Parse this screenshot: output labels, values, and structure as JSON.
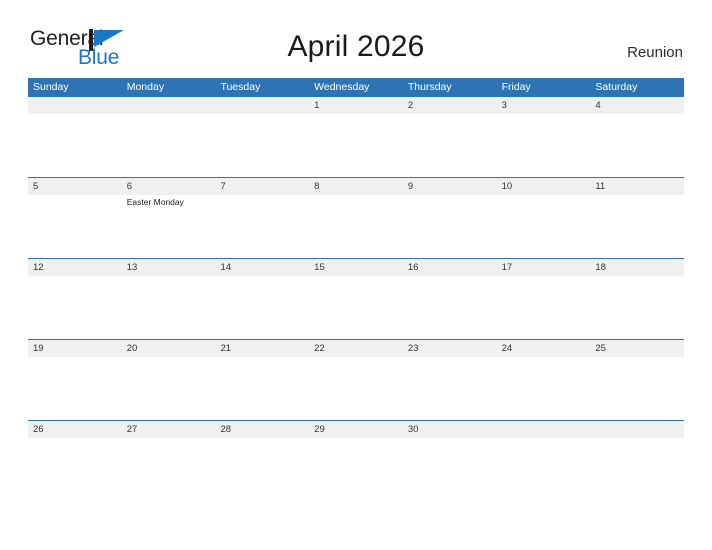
{
  "brand": {
    "name_top": "General",
    "name_bottom": "Blue",
    "color_dark": "#231f20",
    "color_blue": "#1878c4"
  },
  "header": {
    "title": "April 2026",
    "region": "Reunion"
  },
  "theme": {
    "header_blue": "#2e74b5",
    "band_gray": "#f0f0f0",
    "page_background": "#ffffff"
  },
  "weekdays": [
    {
      "label": "Sunday"
    },
    {
      "label": "Monday"
    },
    {
      "label": "Tuesday"
    },
    {
      "label": "Wednesday"
    },
    {
      "label": "Thursday"
    },
    {
      "label": "Friday"
    },
    {
      "label": "Saturday"
    }
  ],
  "weeks": [
    {
      "days": [
        {
          "date": "",
          "event": ""
        },
        {
          "date": "",
          "event": ""
        },
        {
          "date": "",
          "event": ""
        },
        {
          "date": "1",
          "event": ""
        },
        {
          "date": "2",
          "event": ""
        },
        {
          "date": "3",
          "event": ""
        },
        {
          "date": "4",
          "event": ""
        }
      ]
    },
    {
      "days": [
        {
          "date": "5",
          "event": ""
        },
        {
          "date": "6",
          "event": "Easter Monday"
        },
        {
          "date": "7",
          "event": ""
        },
        {
          "date": "8",
          "event": ""
        },
        {
          "date": "9",
          "event": ""
        },
        {
          "date": "10",
          "event": ""
        },
        {
          "date": "11",
          "event": ""
        }
      ]
    },
    {
      "days": [
        {
          "date": "12",
          "event": ""
        },
        {
          "date": "13",
          "event": ""
        },
        {
          "date": "14",
          "event": ""
        },
        {
          "date": "15",
          "event": ""
        },
        {
          "date": "16",
          "event": ""
        },
        {
          "date": "17",
          "event": ""
        },
        {
          "date": "18",
          "event": ""
        }
      ]
    },
    {
      "days": [
        {
          "date": "19",
          "event": ""
        },
        {
          "date": "20",
          "event": ""
        },
        {
          "date": "21",
          "event": ""
        },
        {
          "date": "22",
          "event": ""
        },
        {
          "date": "23",
          "event": ""
        },
        {
          "date": "24",
          "event": ""
        },
        {
          "date": "25",
          "event": ""
        }
      ]
    },
    {
      "days": [
        {
          "date": "26",
          "event": ""
        },
        {
          "date": "27",
          "event": ""
        },
        {
          "date": "28",
          "event": ""
        },
        {
          "date": "29",
          "event": ""
        },
        {
          "date": "30",
          "event": ""
        },
        {
          "date": "",
          "event": ""
        },
        {
          "date": "",
          "event": ""
        }
      ]
    }
  ]
}
